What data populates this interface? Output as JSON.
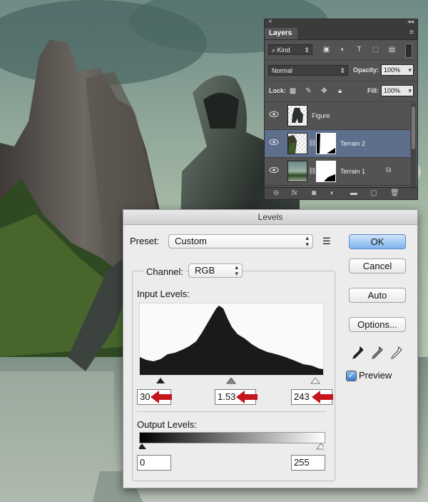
{
  "layers_panel": {
    "tab_label": "Layers",
    "filter_kind": "Kind",
    "blend_mode": "Normal",
    "opacity_label": "Opacity:",
    "opacity_value": "100%",
    "lock_label": "Lock:",
    "fill_label": "Fill:",
    "fill_value": "100%",
    "layers": [
      {
        "name": "Figure",
        "selected": false
      },
      {
        "name": "Terrain 2",
        "selected": true
      },
      {
        "name": "Terrain 1",
        "selected": false
      }
    ],
    "footer_icons": [
      "link-icon",
      "fx-icon",
      "mask-icon",
      "adjustment-icon",
      "group-icon",
      "new-layer-icon",
      "trash-icon"
    ]
  },
  "levels_dialog": {
    "title": "Levels",
    "preset_label": "Preset:",
    "preset_value": "Custom",
    "channel_label": "Channel:",
    "channel_value": "RGB",
    "input_levels_label": "Input Levels:",
    "input_black": "30",
    "input_gamma": "1.53",
    "input_white": "243",
    "output_levels_label": "Output Levels:",
    "output_black": "0",
    "output_white": "255",
    "ok_label": "OK",
    "cancel_label": "Cancel",
    "auto_label": "Auto",
    "options_label": "Options...",
    "preview_label": "Preview",
    "preview_checked": true,
    "slider_positions": {
      "black": 0.118,
      "gamma": 0.5,
      "white": 0.953
    },
    "colors": {
      "accent_button": "#7fb3ee",
      "arrow_red": "#c4161c",
      "histogram": "#1a1a1a"
    }
  }
}
